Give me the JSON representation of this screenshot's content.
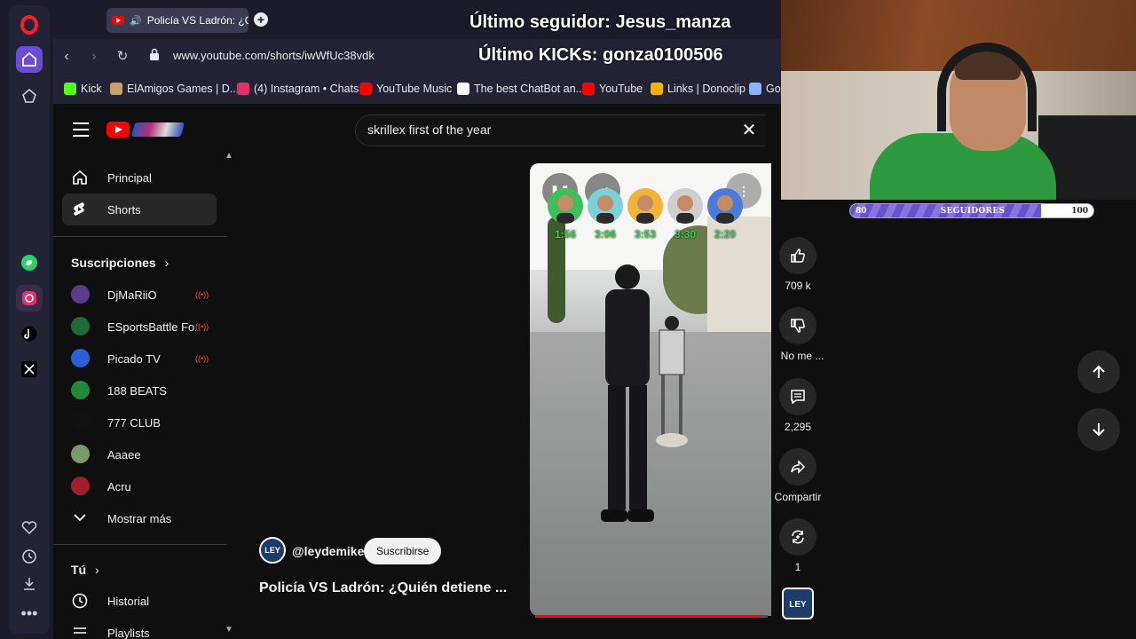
{
  "browser": {
    "tab_title": "Policía VS Ladrón: ¿Qu",
    "url": "www.youtube.com/shorts/iwWfUc38vdk",
    "bookmarks": [
      {
        "label": "Kick",
        "icon": "kick-icon",
        "color": "#53fc18"
      },
      {
        "label": "ElAmigos Games | D...",
        "icon": "elamigos-icon",
        "color": "#c9a06a"
      },
      {
        "label": "(4) Instagram • Chats",
        "icon": "instagram-icon",
        "color": "#e1306c"
      },
      {
        "label": "YouTube Music",
        "icon": "youtube-music-icon",
        "color": "#ff0000"
      },
      {
        "label": "The best ChatBot an...",
        "icon": "chatbot-icon",
        "color": "#ffffff"
      },
      {
        "label": "YouTube",
        "icon": "youtube-icon",
        "color": "#ff0000"
      },
      {
        "label": "Links | Donoclip",
        "icon": "donoclip-icon",
        "color": "#f5b301"
      },
      {
        "label": "Go",
        "icon": "gemini-icon",
        "color": "#8ab4f8"
      }
    ]
  },
  "stream_overlay": {
    "last_follower": "Último seguidor: Jesus_manza",
    "last_kicks": "Último KICKs: gonza0100506",
    "followers_bar": {
      "min": "80",
      "label": "SEGUIDORES",
      "max": "100",
      "progress": 0.78
    }
  },
  "youtube": {
    "search_query": "skrillex first of the year",
    "nav": [
      {
        "label": "Principal",
        "icon": "home-icon"
      },
      {
        "label": "Shorts",
        "icon": "shorts-icon"
      }
    ],
    "subscriptions_title": "Suscripciones",
    "subscriptions": [
      {
        "label": "DjMaRiiO",
        "live": true,
        "color": "#5a3b8c"
      },
      {
        "label": "ESportsBattle Fo...",
        "live": true,
        "color": "#1c6b3a"
      },
      {
        "label": "Picado TV",
        "live": true,
        "color": "#2c5fd6"
      },
      {
        "label": "188 BEATS",
        "live": false,
        "color": "#1f8a3a"
      },
      {
        "label": "777 CLUB",
        "live": false,
        "color": "#111111"
      },
      {
        "label": "Aaaee",
        "live": false,
        "color": "#7a9a6a"
      },
      {
        "label": "Acru",
        "live": false,
        "color": "#a11d2b"
      }
    ],
    "show_more": "Mostrar más",
    "you_title": "Tú",
    "you_items": [
      {
        "label": "Historial",
        "icon": "history-icon"
      },
      {
        "label": "Playlists",
        "icon": "playlists-icon"
      }
    ],
    "short": {
      "channel": "@leydemike",
      "channel_avatar_text": "LEY",
      "subscribe": "Suscribirse",
      "title": "Policía VS Ladrón: ¿Quién detiene ...",
      "progress": 0.97,
      "timers": [
        "1:56",
        "3:06",
        "3:53",
        "3:30",
        "2:20"
      ]
    },
    "actions": {
      "likes": "709 k",
      "dislike": "No me ...",
      "comments": "2,295",
      "share": "Compartir",
      "remix": "1"
    }
  }
}
